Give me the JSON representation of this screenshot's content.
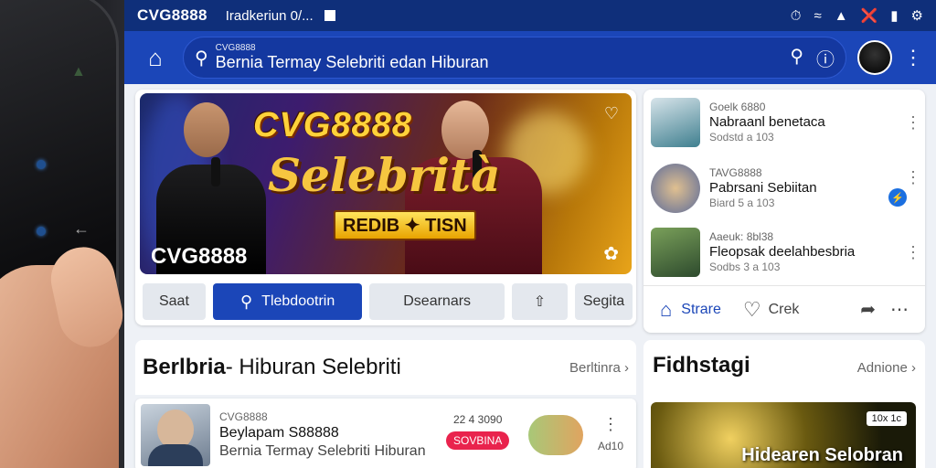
{
  "status_bar": {
    "brand": "CVG8888",
    "message": "Iradkeriun 0/...",
    "right_icons": [
      "alarm-icon",
      "wifi-icon",
      "signal-icon",
      "mute-icon",
      "battery-icon",
      "settings-icon"
    ]
  },
  "app_bar": {
    "search_small": "CVG8888",
    "search_text": "Bernia Termay Selebriti edan Hiburan",
    "icons": [
      "search-icon",
      "help-icon",
      "avatar",
      "more-vertical-icon"
    ]
  },
  "hero": {
    "logo": "CVG8888",
    "script": "Selebrità",
    "badge": "REDIB ✦ TISN",
    "brand_overlay": "CVG8888"
  },
  "hero_actions": [
    {
      "label": "Saat",
      "type": "plain"
    },
    {
      "label": "Tlebdootrin",
      "type": "primary",
      "icon": "search"
    },
    {
      "label": "Dsearnars",
      "type": "plain"
    },
    {
      "label": "",
      "type": "icon",
      "icon": "share"
    },
    {
      "label": "Segita",
      "type": "plain"
    }
  ],
  "feed": {
    "items": [
      {
        "t1": "Goelk 6880",
        "t2": "Nabraanl benetaca",
        "t3": "Sodstd a 103"
      },
      {
        "t1": "TAVG8888",
        "t2": "Pabrsani Sebiitan",
        "t3": "Biard 5 a 103"
      },
      {
        "t1": "Aaeuk: 8bl38",
        "t2": "Fleopsak deelahbesbria",
        "t3": "Sodbs 3 a 103"
      }
    ],
    "footer": {
      "share_label": "Strare",
      "like_label": "Crek"
    }
  },
  "section_left": {
    "title_bold": "Berlbria",
    "title_rest": "- Hiburan Selebriti",
    "link": "Berltinra ›",
    "item": {
      "l1": "CVG8888",
      "l2": "Beylapam S88888",
      "l3": "Bernia Termay Selebriti Hiburan",
      "date": "22 4 3090",
      "pill": "SOVBINA",
      "count": "Ad10"
    }
  },
  "section_right": {
    "title": "Fidhstagi",
    "link": "Adnione ›",
    "promo_tag": "10x 1c",
    "promo_caption": "Hidearen Selobran"
  }
}
